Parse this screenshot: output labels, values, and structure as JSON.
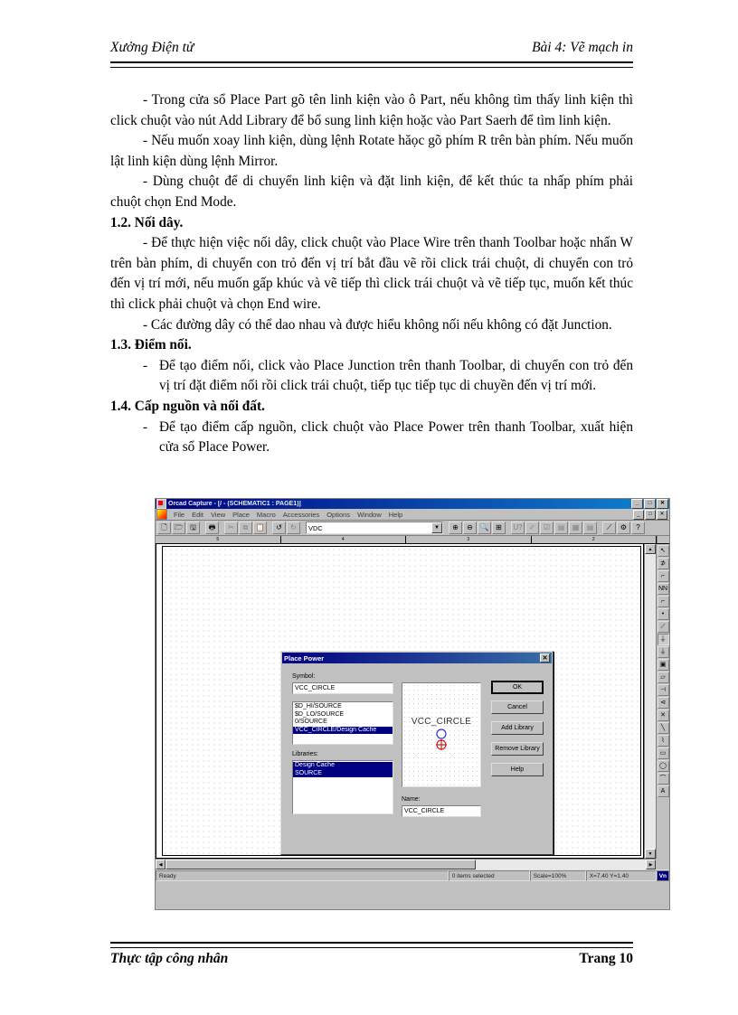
{
  "header": {
    "left": "Xưởng Điện tử",
    "right": "Bài 4: Vẽ mạch in"
  },
  "footer": {
    "left": "Thực tập công nhân",
    "right": "Trang 10"
  },
  "body": {
    "p1": "- Trong cửa sổ Place Part gõ tên linh kiện vào ô Part, nếu không tìm thấy linh kiện thì click chuột vào nút Add Library để bổ sung linh kiện hoặc vào Part Saerh để tìm linh kiện.",
    "p2": "- Nếu muốn xoay linh kiện, dùng lệnh Rotate hăọc gõ phím R trên bàn phím. Nếu muốn lật linh kiện dùng lệnh Mirror.",
    "p3": "- Dùng chuột để di chuyển linh kiện và đặt linh kiện, để kết thúc ta nhấp phím phải chuột chọn End Mode.",
    "h12": "1.2. Nối dây.",
    "p4": "- Để thực hiện việc nối dây, click chuột vào Place Wire trên thanh Toolbar hoặc nhấn W trên bàn phím, di chuyển con trỏ đến vị trí bắt đầu vẽ rồi click trái chuột, di chuyển con trỏ đến vị trí mới, nếu muốn gấp khúc và vẽ tiếp thì click trái chuột và vẽ tiếp tục, muốn kết thúc thì click phải chuột và chọn End wire.",
    "p5": "- Các đường dây có thể dao nhau và được hiểu không nối nếu không có đặt Junction.",
    "h13": "1.3. Điểm nối.",
    "dash": "-",
    "p6": "Để tạo điểm nối, click vào Place Junction trên thanh Toolbar, di chuyển con trỏ đến vị trí đặt điểm nối rồi click trái chuột, tiếp tục tiếp tục di chuyền đến vị trí mới.",
    "h14": "1.4. Cấp nguồn và nối đất.",
    "p7": "Để tạo điểm cấp nguồn, click chuột vào Place Power trên thanh Toolbar, xuất hiện cửa sổ Place Power."
  },
  "app": {
    "title": "Orcad Capture - [/ - (SCHEMATIC1 : PAGE1)]",
    "window_buttons": [
      "_",
      "□",
      "✕"
    ],
    "child_buttons": [
      "_",
      "□",
      "✕"
    ],
    "menus": [
      "File",
      "Edit",
      "View",
      "Place",
      "Macro",
      "Accessories",
      "Options",
      "Window",
      "Help"
    ],
    "toolbar": {
      "buttons": [
        {
          "name": "new-file-icon",
          "glyph": "🗋"
        },
        {
          "name": "open-folder-icon",
          "glyph": "🗁"
        },
        {
          "name": "save-icon",
          "glyph": "🖫"
        },
        {
          "name": "print-icon",
          "glyph": "🖶"
        },
        {
          "name": "cut-icon",
          "glyph": "✂"
        },
        {
          "name": "copy-icon",
          "glyph": "⧉"
        },
        {
          "name": "paste-icon",
          "glyph": "📋"
        },
        {
          "name": "undo-icon",
          "glyph": "↺"
        },
        {
          "name": "redo-icon",
          "glyph": "↻"
        }
      ],
      "combo_value": "VDC",
      "buttons2": [
        {
          "name": "zoom-in-icon",
          "glyph": "⊕"
        },
        {
          "name": "zoom-out-icon",
          "glyph": "⊖"
        },
        {
          "name": "zoom-area-icon",
          "glyph": "🔍"
        },
        {
          "name": "zoom-all-icon",
          "glyph": "⊞"
        },
        {
          "name": "annotate-icon",
          "glyph": "U?"
        },
        {
          "name": "backannotate-icon",
          "glyph": "✓"
        },
        {
          "name": "design-rules-icon",
          "glyph": "☑"
        },
        {
          "name": "create-netlist-icon",
          "glyph": "▤"
        },
        {
          "name": "cross-reference-icon",
          "glyph": "▦"
        },
        {
          "name": "bill-of-materials-icon",
          "glyph": "▤"
        },
        {
          "name": "snap-to-grid-icon",
          "glyph": "⟋"
        },
        {
          "name": "project-manager-icon",
          "glyph": "⚙"
        },
        {
          "name": "help-icon",
          "glyph": "?"
        }
      ]
    },
    "ruler_labels": [
      "5",
      "4",
      "3",
      "2"
    ],
    "toolbox": [
      {
        "name": "select-tool-icon",
        "glyph": "↖"
      },
      {
        "name": "place-part-icon",
        "glyph": "⊅"
      },
      {
        "name": "place-wire-icon",
        "glyph": "⌐"
      },
      {
        "name": "place-net-alias-icon",
        "glyph": "NN"
      },
      {
        "name": "place-bus-icon",
        "glyph": "⌐"
      },
      {
        "name": "place-junction-icon",
        "glyph": "•"
      },
      {
        "name": "place-bus-entry-icon",
        "glyph": "⟋"
      },
      {
        "name": "place-power-icon",
        "glyph": "⏚"
      },
      {
        "name": "place-ground-icon",
        "glyph": "⏚"
      },
      {
        "name": "place-hierarchical-block-icon",
        "glyph": "▣"
      },
      {
        "name": "place-port-icon",
        "glyph": "▱"
      },
      {
        "name": "place-pin-icon",
        "glyph": "⊣"
      },
      {
        "name": "place-offpage-connector-icon",
        "glyph": "⊲"
      },
      {
        "name": "place-no-connect-icon",
        "glyph": "✕"
      },
      {
        "name": "place-line-icon",
        "glyph": "╲"
      },
      {
        "name": "place-polyline-icon",
        "glyph": "⌇"
      },
      {
        "name": "place-rectangle-icon",
        "glyph": "▭"
      },
      {
        "name": "place-ellipse-icon",
        "glyph": "◯"
      },
      {
        "name": "place-arc-icon",
        "glyph": "⌒"
      },
      {
        "name": "place-text-icon",
        "glyph": "A"
      }
    ],
    "statusbar": {
      "ready": "Ready",
      "items_selected": "0 items selected",
      "scale": "Scale=100%",
      "coords": "X=7.40 Y=1.40",
      "ime": "Vn"
    }
  },
  "dialog": {
    "title": "Place Power",
    "close_label": "✕",
    "symbol_label": "Symbol:",
    "symbol_value": "VCC_CIRCLE",
    "symbol_list": [
      {
        "label": "$D_HI/SOURCE",
        "selected": false
      },
      {
        "label": "$D_LO/SOURCE",
        "selected": false
      },
      {
        "label": "0/SOURCE",
        "selected": false
      },
      {
        "label": "VCC_CIRCLE/Design Cache",
        "selected": true
      }
    ],
    "libraries_label": "Libraries:",
    "libraries_list": [
      {
        "label": "Design Cache",
        "selected": true
      },
      {
        "label": "SOURCE",
        "selected": true
      }
    ],
    "preview_label": "VCC_CIRCLE",
    "name_label": "Name:",
    "name_value": "VCC_CIRCLE",
    "buttons": [
      {
        "name": "ok-button",
        "label": "OK"
      },
      {
        "name": "cancel-button",
        "label": "Cancel"
      },
      {
        "name": "add-library-button",
        "label": "Add Library"
      },
      {
        "name": "remove-library-button",
        "label": "Remove Library"
      },
      {
        "name": "help-button",
        "label": "Help"
      }
    ]
  },
  "colors": {
    "title_blue": "#000080",
    "face": "#c0c0c0",
    "select_blue": "#000080"
  }
}
